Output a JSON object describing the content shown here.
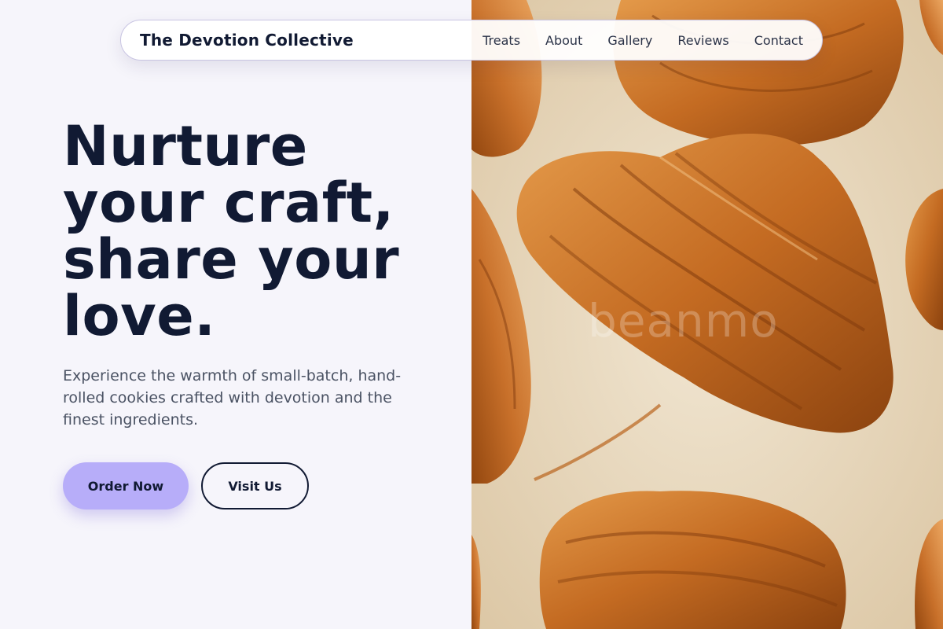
{
  "navbar": {
    "brand": "The Devotion Collective",
    "links": [
      "Treats",
      "About",
      "Gallery",
      "Reviews",
      "Contact"
    ]
  },
  "hero": {
    "headline": "Nurture your craft, share your love.",
    "subtext": "Experience the warmth of small-batch, hand-rolled cookies crafted with devotion and the finest ingredients.",
    "primary_cta": "Order Now",
    "secondary_cta": "Visit Us"
  },
  "image": {
    "subject": "croissants-on-baking-sheet",
    "watermark": "beanmo"
  },
  "colors": {
    "background": "#f6f5fb",
    "text": "#111a33",
    "muted_text": "#4a5263",
    "accent": "#b7adf9",
    "nav_border": "#c8c4e2"
  }
}
